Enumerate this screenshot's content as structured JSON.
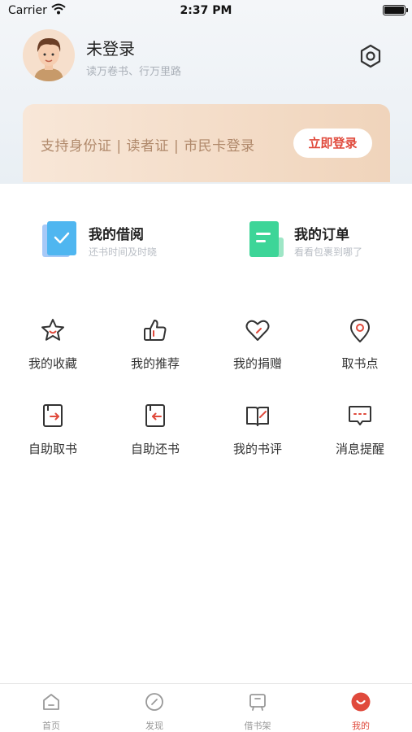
{
  "status_bar": {
    "carrier": "Carrier",
    "time": "2:37 PM"
  },
  "profile": {
    "name": "未登录",
    "motto": "读万卷书、行万里路"
  },
  "login_banner": {
    "text": "支持身份证 | 读者证 | 市民卡登录",
    "button_label": "立即登录"
  },
  "quick_links": [
    {
      "title": "我的借阅",
      "subtitle": "还书时间及时晓",
      "icon": "borrow-icon"
    },
    {
      "title": "我的订单",
      "subtitle": "看看包裹到哪了",
      "icon": "order-icon"
    }
  ],
  "grid": [
    {
      "label": "我的收藏",
      "icon": "star-icon"
    },
    {
      "label": "我的推荐",
      "icon": "thumbs-up-icon"
    },
    {
      "label": "我的捐赠",
      "icon": "heart-icon"
    },
    {
      "label": "取书点",
      "icon": "location-pin-icon"
    },
    {
      "label": "自助取书",
      "icon": "book-pickup-icon"
    },
    {
      "label": "自助还书",
      "icon": "book-return-icon"
    },
    {
      "label": "我的书评",
      "icon": "book-review-icon"
    },
    {
      "label": "消息提醒",
      "icon": "message-icon"
    }
  ],
  "tabs": [
    {
      "label": "首页",
      "icon": "home-icon"
    },
    {
      "label": "发现",
      "icon": "compass-icon"
    },
    {
      "label": "借书架",
      "icon": "bookshelf-icon"
    },
    {
      "label": "我的",
      "icon": "profile-icon"
    }
  ],
  "colors": {
    "accent": "#e04a3c",
    "banner_text": "#b0896b",
    "borrow_icon": "#4fb6f0",
    "order_icon": "#3dd598"
  }
}
